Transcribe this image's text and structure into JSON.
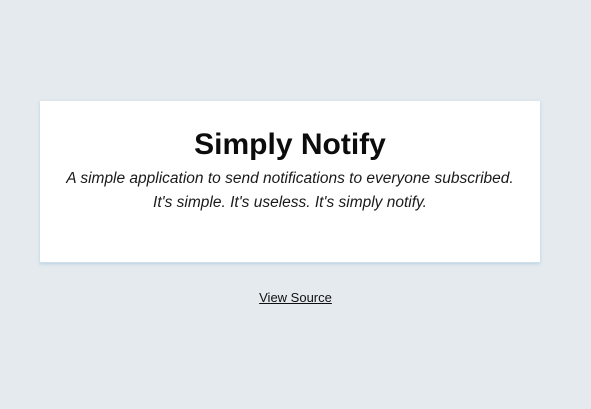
{
  "card": {
    "title": "Simply Notify",
    "tagline_line1": "A simple application to send notifications to everyone subscribed.",
    "tagline_line2": "It's simple. It's useless. It's simply notify."
  },
  "footer": {
    "view_source_label": "View Source"
  },
  "colors": {
    "page_background": "#e4eaee",
    "card_background": "#ffffff",
    "text": "#111111"
  }
}
